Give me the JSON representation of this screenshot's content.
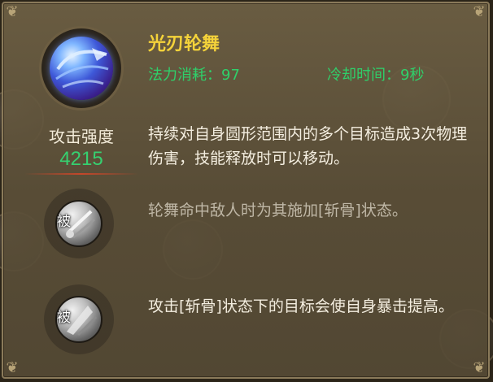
{
  "skill": {
    "name": "光刃轮舞",
    "cost": "法力消耗：97",
    "cooldown": "冷却时间：9秒",
    "description": "持续对自身圆形范围内的多个目标造成3次物理伤害，技能释放时可以移动。"
  },
  "attack": {
    "label": "攻击强度",
    "value": "4215"
  },
  "passives": [
    {
      "tag": "被",
      "text": "轮舞命中敌人时为其施加[斩骨]状态。"
    },
    {
      "tag": "被",
      "text": "攻击[斩骨]状态下的目标会使自身暴击提高。"
    }
  ],
  "colors": {
    "name": "#f4d23a",
    "stats": "#2fd06a",
    "attack_value": "#36d070",
    "text": "#f4eee0",
    "muted_text": "#bfb7a6"
  }
}
